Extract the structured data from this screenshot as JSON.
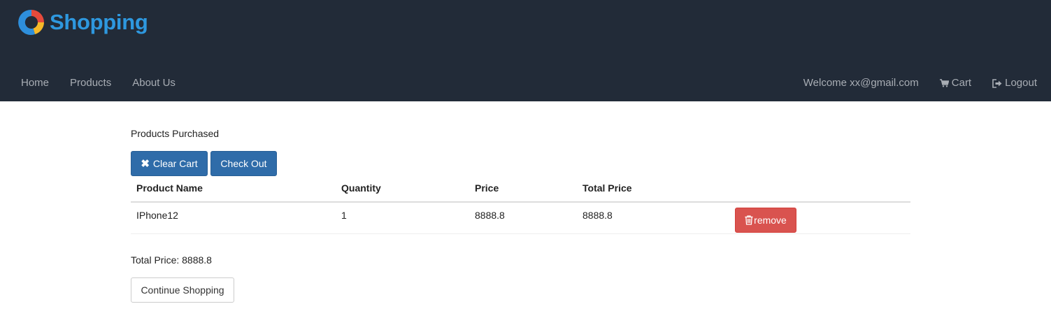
{
  "brand": {
    "name": "Shopping",
    "logo_icon": "shopping-logo-icon",
    "text_color": "#2e98df"
  },
  "nav": {
    "left": [
      {
        "label": "Home"
      },
      {
        "label": "Products"
      },
      {
        "label": "About Us"
      }
    ],
    "welcome": "Welcome xx@gmail.com",
    "cart_label": "Cart",
    "cart_icon": "cart-icon",
    "logout_label": "Logout",
    "logout_icon": "logout-icon"
  },
  "main": {
    "title": "Products Purchased",
    "clear_cart_label": "Clear Cart",
    "clear_cart_icon": "close-icon",
    "checkout_label": "Check Out",
    "table": {
      "headers": [
        "Product Name",
        "Quantity",
        "Price",
        "Total Price"
      ],
      "rows": [
        {
          "name": "IPhone12",
          "quantity": "1",
          "price": "8888.8",
          "total": "8888.8",
          "remove_label": "remove",
          "remove_icon": "trash-icon"
        }
      ]
    },
    "total_price": "Total Price: 8888.8",
    "continue_label": "Continue Shopping"
  },
  "colors": {
    "topbar": "#222b38",
    "primary": "#2f6ca9",
    "danger": "#d9534f",
    "nav_text": "#a8adb4"
  }
}
